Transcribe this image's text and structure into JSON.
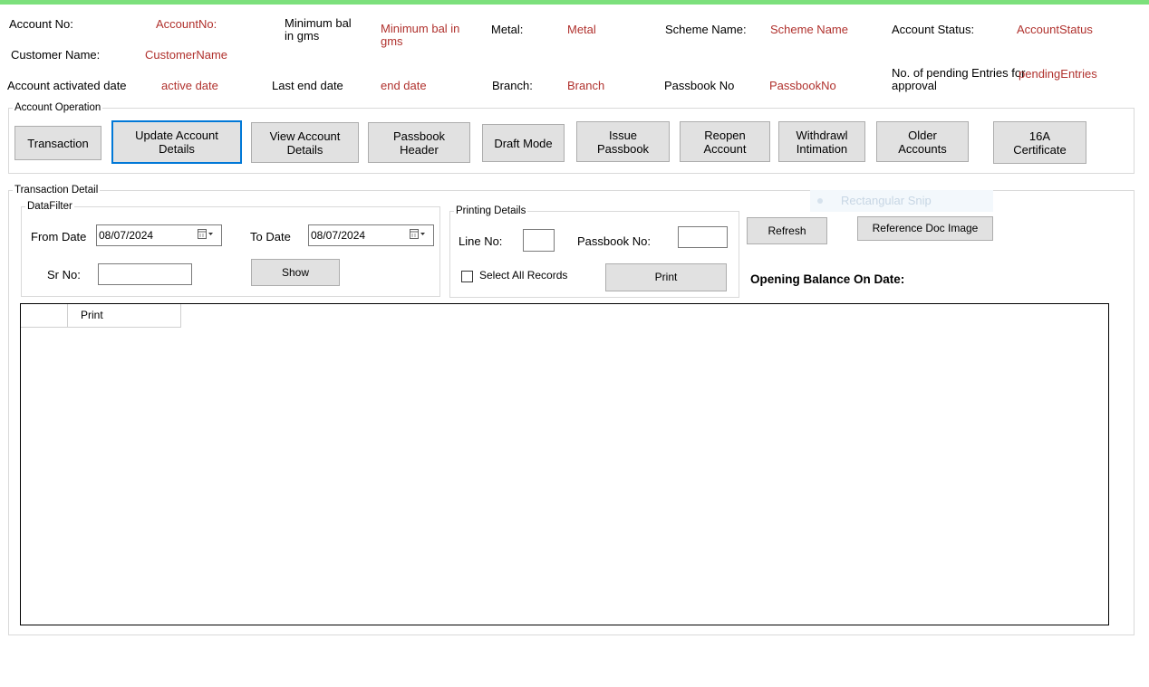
{
  "header": {
    "account_no_label": "Account No:",
    "account_no_value": "AccountNo:",
    "min_bal_label": "Minimum bal in gms",
    "min_bal_value": "Minimum bal in gms",
    "metal_label": "Metal:",
    "metal_value": "Metal",
    "scheme_label": "Scheme Name:",
    "scheme_value": "Scheme Name",
    "status_label": "Account Status:",
    "status_value": "AccountStatus",
    "customer_label": "Customer Name:",
    "customer_value": "CustomerName",
    "activated_label": "Account activated date",
    "activated_value": "active date",
    "last_end_label": "Last end date",
    "last_end_value": "end date",
    "branch_label": "Branch:",
    "branch_value": "Branch",
    "passbook_label": "Passbook No",
    "passbook_value": "PassbookNo",
    "pending_label": "No. of pending Entries for approval",
    "pending_value": "pendingEntries"
  },
  "account_operation": {
    "legend": "Account Operation",
    "buttons": [
      "Transaction",
      "Update Account\nDetails",
      "View Account\nDetails",
      "Passbook\nHeader",
      "Draft Mode",
      "Issue\nPassbook",
      "Reopen\nAccount",
      "Withdrawl\nIntimation",
      "Older\nAccounts",
      "16A\nCertificate"
    ]
  },
  "transaction_detail": {
    "legend": "Transaction Detail",
    "datafilter": {
      "legend": "DataFilter",
      "from_label": "From Date",
      "from_value": "08/07/2024",
      "to_label": "To Date",
      "to_value": "08/07/2024",
      "sr_label": "Sr No:",
      "sr_value": "",
      "show_button": "Show"
    },
    "printing": {
      "legend": "Printing Details",
      "line_label": "Line No:",
      "line_value": "",
      "passbook_label": "Passbook No:",
      "passbook_value": "",
      "select_all_label": "Select All Records",
      "select_all_checked": false,
      "print_button": "Print"
    },
    "refresh_button": "Refresh",
    "reference_button": "Reference Doc Image",
    "opening_balance_label": "Opening Balance On Date:",
    "grid": {
      "columns": [
        "",
        "Print"
      ]
    }
  },
  "snip_ghost": "Rectangular Snip",
  "colors": {
    "accent_bar": "#7ce07c",
    "value_text": "#b0312d",
    "focus_border": "#0078d7"
  }
}
